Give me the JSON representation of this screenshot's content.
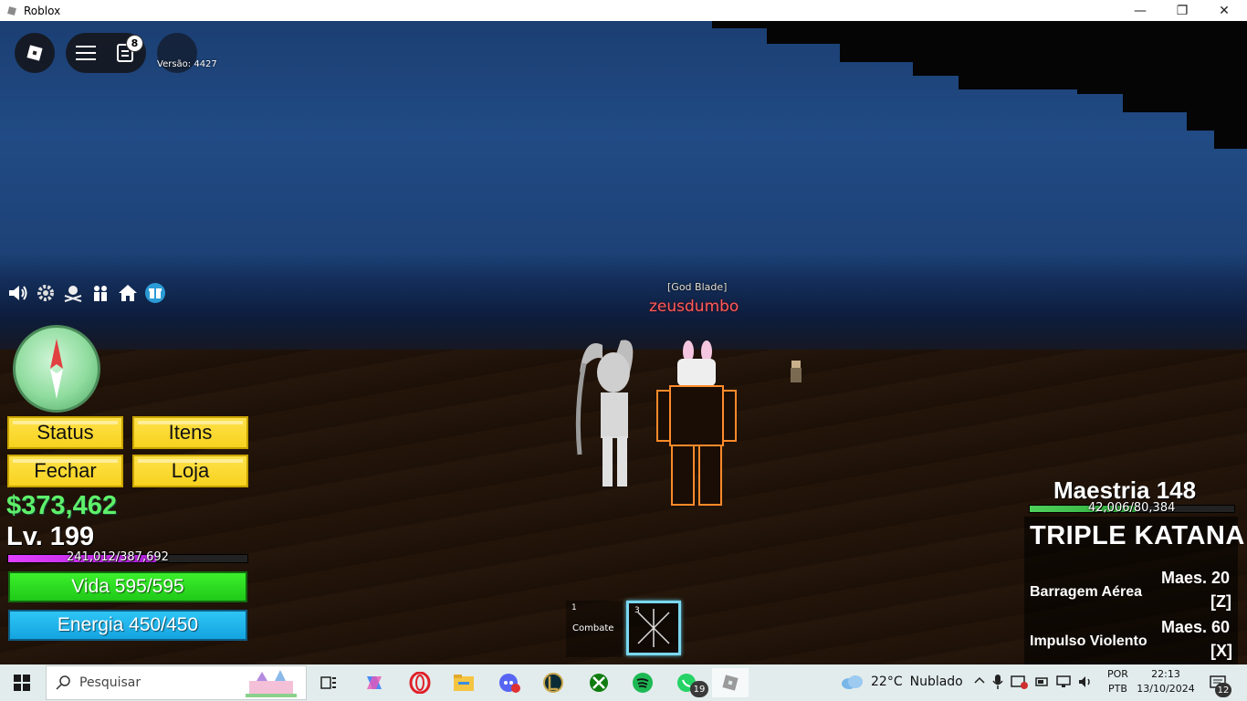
{
  "window": {
    "title": "Roblox",
    "controls": {
      "minimize": "—",
      "maximize": "❐",
      "close": "✕"
    }
  },
  "topbar": {
    "chat_badge": "8",
    "version_label": "Versão: 4427"
  },
  "side_icons": [
    "speaker-icon",
    "gear-icon",
    "jolly-roger-icon",
    "crew-icon",
    "home-icon",
    "gift-icon"
  ],
  "menu": {
    "status": "Status",
    "items": "Itens",
    "close": "Fechar",
    "shop": "Loja"
  },
  "player": {
    "money": "$373,462",
    "level": "Lv. 199",
    "xp_text": "241,012/387,692",
    "xp_fraction": 0.62,
    "health": "Vida 595/595",
    "energy": "Energia 450/450"
  },
  "character": {
    "title_tag": "[God Blade]",
    "name": "zeusdumbo"
  },
  "hotbar": {
    "slot1_num": "1",
    "slot1_label": "Combate",
    "slot2_num": "3"
  },
  "weapon": {
    "mastery_title": "Maestria 148",
    "mastery_text": "42,006/80,384",
    "mastery_fraction": 0.52,
    "name": "TRIPLE KATANA",
    "skills": [
      {
        "name": "Barragem Aérea",
        "mastery": "Maes. 20",
        "key": "[Z]"
      },
      {
        "name": "Impulso Violento",
        "mastery": "Maes. 60",
        "key": "[X]"
      }
    ]
  },
  "taskbar": {
    "search_placeholder": "Pesquisar",
    "whatsapp_badge": "19",
    "weather_temp": "22°C",
    "weather_desc": "Nublado",
    "lang_line1": "POR",
    "lang_line2": "PTB",
    "time": "22:13",
    "date": "13/10/2024",
    "notification_count": "12"
  },
  "colors": {
    "money": "#5ff06a",
    "name": "#ff5b5b",
    "button_yellow": "#f7d21e",
    "health_green": "#20c918",
    "energy_blue": "#14a4e0",
    "selected_slot": "#7ad7ef"
  }
}
